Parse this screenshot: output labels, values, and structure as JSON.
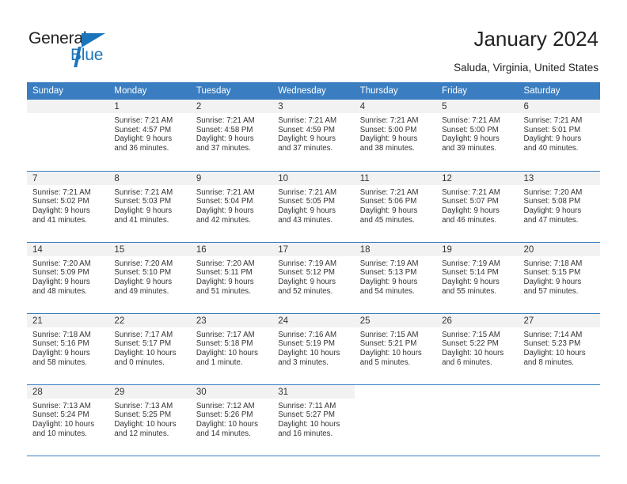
{
  "brand": {
    "name_part1": "General",
    "name_part2": "Blue",
    "accent_color": "#1b75bb"
  },
  "header": {
    "title": "January 2024",
    "location": "Saluda, Virginia, United States"
  },
  "calendar": {
    "header_bg": "#3a7ec1",
    "weekday_headers": [
      "Sunday",
      "Monday",
      "Tuesday",
      "Wednesday",
      "Thursday",
      "Friday",
      "Saturday"
    ],
    "weeks": [
      [
        {
          "day": "",
          "sunrise": "",
          "sunset": "",
          "daylight_line1": "",
          "daylight_line2": "",
          "empty": true
        },
        {
          "day": "1",
          "sunrise": "Sunrise: 7:21 AM",
          "sunset": "Sunset: 4:57 PM",
          "daylight_line1": "Daylight: 9 hours",
          "daylight_line2": "and 36 minutes."
        },
        {
          "day": "2",
          "sunrise": "Sunrise: 7:21 AM",
          "sunset": "Sunset: 4:58 PM",
          "daylight_line1": "Daylight: 9 hours",
          "daylight_line2": "and 37 minutes."
        },
        {
          "day": "3",
          "sunrise": "Sunrise: 7:21 AM",
          "sunset": "Sunset: 4:59 PM",
          "daylight_line1": "Daylight: 9 hours",
          "daylight_line2": "and 37 minutes."
        },
        {
          "day": "4",
          "sunrise": "Sunrise: 7:21 AM",
          "sunset": "Sunset: 5:00 PM",
          "daylight_line1": "Daylight: 9 hours",
          "daylight_line2": "and 38 minutes."
        },
        {
          "day": "5",
          "sunrise": "Sunrise: 7:21 AM",
          "sunset": "Sunset: 5:00 PM",
          "daylight_line1": "Daylight: 9 hours",
          "daylight_line2": "and 39 minutes."
        },
        {
          "day": "6",
          "sunrise": "Sunrise: 7:21 AM",
          "sunset": "Sunset: 5:01 PM",
          "daylight_line1": "Daylight: 9 hours",
          "daylight_line2": "and 40 minutes."
        }
      ],
      [
        {
          "day": "7",
          "sunrise": "Sunrise: 7:21 AM",
          "sunset": "Sunset: 5:02 PM",
          "daylight_line1": "Daylight: 9 hours",
          "daylight_line2": "and 41 minutes."
        },
        {
          "day": "8",
          "sunrise": "Sunrise: 7:21 AM",
          "sunset": "Sunset: 5:03 PM",
          "daylight_line1": "Daylight: 9 hours",
          "daylight_line2": "and 41 minutes."
        },
        {
          "day": "9",
          "sunrise": "Sunrise: 7:21 AM",
          "sunset": "Sunset: 5:04 PM",
          "daylight_line1": "Daylight: 9 hours",
          "daylight_line2": "and 42 minutes."
        },
        {
          "day": "10",
          "sunrise": "Sunrise: 7:21 AM",
          "sunset": "Sunset: 5:05 PM",
          "daylight_line1": "Daylight: 9 hours",
          "daylight_line2": "and 43 minutes."
        },
        {
          "day": "11",
          "sunrise": "Sunrise: 7:21 AM",
          "sunset": "Sunset: 5:06 PM",
          "daylight_line1": "Daylight: 9 hours",
          "daylight_line2": "and 45 minutes."
        },
        {
          "day": "12",
          "sunrise": "Sunrise: 7:21 AM",
          "sunset": "Sunset: 5:07 PM",
          "daylight_line1": "Daylight: 9 hours",
          "daylight_line2": "and 46 minutes."
        },
        {
          "day": "13",
          "sunrise": "Sunrise: 7:20 AM",
          "sunset": "Sunset: 5:08 PM",
          "daylight_line1": "Daylight: 9 hours",
          "daylight_line2": "and 47 minutes."
        }
      ],
      [
        {
          "day": "14",
          "sunrise": "Sunrise: 7:20 AM",
          "sunset": "Sunset: 5:09 PM",
          "daylight_line1": "Daylight: 9 hours",
          "daylight_line2": "and 48 minutes."
        },
        {
          "day": "15",
          "sunrise": "Sunrise: 7:20 AM",
          "sunset": "Sunset: 5:10 PM",
          "daylight_line1": "Daylight: 9 hours",
          "daylight_line2": "and 49 minutes."
        },
        {
          "day": "16",
          "sunrise": "Sunrise: 7:20 AM",
          "sunset": "Sunset: 5:11 PM",
          "daylight_line1": "Daylight: 9 hours",
          "daylight_line2": "and 51 minutes."
        },
        {
          "day": "17",
          "sunrise": "Sunrise: 7:19 AM",
          "sunset": "Sunset: 5:12 PM",
          "daylight_line1": "Daylight: 9 hours",
          "daylight_line2": "and 52 minutes."
        },
        {
          "day": "18",
          "sunrise": "Sunrise: 7:19 AM",
          "sunset": "Sunset: 5:13 PM",
          "daylight_line1": "Daylight: 9 hours",
          "daylight_line2": "and 54 minutes."
        },
        {
          "day": "19",
          "sunrise": "Sunrise: 7:19 AM",
          "sunset": "Sunset: 5:14 PM",
          "daylight_line1": "Daylight: 9 hours",
          "daylight_line2": "and 55 minutes."
        },
        {
          "day": "20",
          "sunrise": "Sunrise: 7:18 AM",
          "sunset": "Sunset: 5:15 PM",
          "daylight_line1": "Daylight: 9 hours",
          "daylight_line2": "and 57 minutes."
        }
      ],
      [
        {
          "day": "21",
          "sunrise": "Sunrise: 7:18 AM",
          "sunset": "Sunset: 5:16 PM",
          "daylight_line1": "Daylight: 9 hours",
          "daylight_line2": "and 58 minutes."
        },
        {
          "day": "22",
          "sunrise": "Sunrise: 7:17 AM",
          "sunset": "Sunset: 5:17 PM",
          "daylight_line1": "Daylight: 10 hours",
          "daylight_line2": "and 0 minutes."
        },
        {
          "day": "23",
          "sunrise": "Sunrise: 7:17 AM",
          "sunset": "Sunset: 5:18 PM",
          "daylight_line1": "Daylight: 10 hours",
          "daylight_line2": "and 1 minute."
        },
        {
          "day": "24",
          "sunrise": "Sunrise: 7:16 AM",
          "sunset": "Sunset: 5:19 PM",
          "daylight_line1": "Daylight: 10 hours",
          "daylight_line2": "and 3 minutes."
        },
        {
          "day": "25",
          "sunrise": "Sunrise: 7:15 AM",
          "sunset": "Sunset: 5:21 PM",
          "daylight_line1": "Daylight: 10 hours",
          "daylight_line2": "and 5 minutes."
        },
        {
          "day": "26",
          "sunrise": "Sunrise: 7:15 AM",
          "sunset": "Sunset: 5:22 PM",
          "daylight_line1": "Daylight: 10 hours",
          "daylight_line2": "and 6 minutes."
        },
        {
          "day": "27",
          "sunrise": "Sunrise: 7:14 AM",
          "sunset": "Sunset: 5:23 PM",
          "daylight_line1": "Daylight: 10 hours",
          "daylight_line2": "and 8 minutes."
        }
      ],
      [
        {
          "day": "28",
          "sunrise": "Sunrise: 7:13 AM",
          "sunset": "Sunset: 5:24 PM",
          "daylight_line1": "Daylight: 10 hours",
          "daylight_line2": "and 10 minutes."
        },
        {
          "day": "29",
          "sunrise": "Sunrise: 7:13 AM",
          "sunset": "Sunset: 5:25 PM",
          "daylight_line1": "Daylight: 10 hours",
          "daylight_line2": "and 12 minutes."
        },
        {
          "day": "30",
          "sunrise": "Sunrise: 7:12 AM",
          "sunset": "Sunset: 5:26 PM",
          "daylight_line1": "Daylight: 10 hours",
          "daylight_line2": "and 14 minutes."
        },
        {
          "day": "31",
          "sunrise": "Sunrise: 7:11 AM",
          "sunset": "Sunset: 5:27 PM",
          "daylight_line1": "Daylight: 10 hours",
          "daylight_line2": "and 16 minutes."
        },
        {
          "day": "",
          "sunrise": "",
          "sunset": "",
          "daylight_line1": "",
          "daylight_line2": "",
          "empty": true,
          "blank": true
        },
        {
          "day": "",
          "sunrise": "",
          "sunset": "",
          "daylight_line1": "",
          "daylight_line2": "",
          "empty": true,
          "blank": true
        },
        {
          "day": "",
          "sunrise": "",
          "sunset": "",
          "daylight_line1": "",
          "daylight_line2": "",
          "empty": true,
          "blank": true
        }
      ]
    ]
  }
}
